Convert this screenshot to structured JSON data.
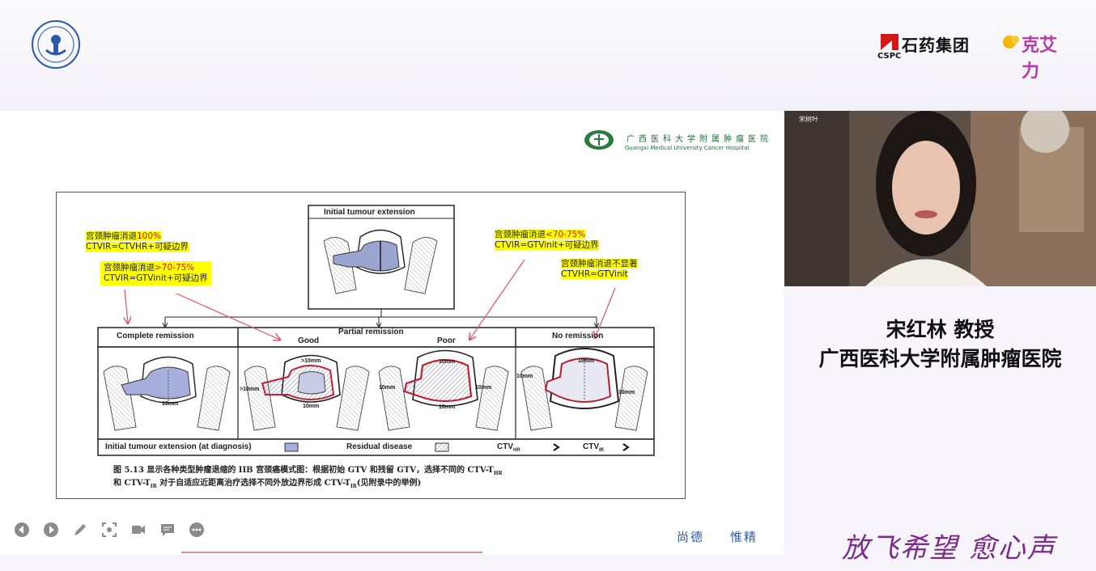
{
  "header": {
    "sponsor_cn": "石药集团",
    "sponsor_en": "CSPC",
    "brand": "克艾力"
  },
  "slide": {
    "hospital_cn": "广西医科大学附属肿瘤医院",
    "hospital_en": "Guangxi Medical University Cancer Hospital",
    "figure": {
      "top_box_label": "Initial tumour extension",
      "col_complete": "Complete remission",
      "col_partial": "Partial remission",
      "sub_good": "Good",
      "sub_poor": "Poor",
      "col_none": "No remission",
      "notes": {
        "n1_a": "宫颈肿瘤消退",
        "n1_b": "100%",
        "n1_c": "CTVIR=CTVHR+可疑边界",
        "n2_a": "宫颈肿瘤消退",
        "n2_b": ">70-75%",
        "n2_c": "CTVIR=GTVinit+可疑边界",
        "n3_a": "宫颈肿瘤消退",
        "n3_b": "<70-75%",
        "n3_c": "CTVIR=GTVinit+可疑边界",
        "n4_a": "宫颈肿瘤消退不显著",
        "n4_c": "CTVHR=GTVinit"
      },
      "mm": {
        "a": "10mm",
        "b": ">10mm",
        "c": ">10mm",
        "d": "10mm",
        "e": "10mm",
        "f": "10mm",
        "g": "10mm",
        "h": "10mm",
        "i": "10mm",
        "j": "10mm",
        "k": "10mm"
      },
      "legend": {
        "initial": "Initial tumour extension (at diagnosis)",
        "residual": "Residual disease",
        "ctv_hr": "CTV",
        "ctv_hr_sub": "HR",
        "ctv_ir": "CTV",
        "ctv_ir_sub": "IR"
      },
      "caption_line1": "图 5.13    显示各种类型肿瘤退缩的 IIB 宫颈癌模式图：根据初始 GTV 和残留 GTV，选择不同的 CTV-T",
      "caption_line1_sub": "HR",
      "caption_line2": "和 CTV-T",
      "caption_line2_sub": "IR",
      "caption_line2_rest": " 对于自适应近距离治疗选择不同外放边界形成 CTV-T",
      "caption_line2_sub2": "IR",
      "caption_line2_end": "(见附录中的举例)"
    },
    "motto_1": "尚德",
    "motto_2": "惟精"
  },
  "toolbar": {
    "icons": [
      "prev-icon",
      "next-icon",
      "pen-icon",
      "screenshot-icon",
      "camera-icon",
      "comment-icon",
      "more-icon"
    ]
  },
  "video": {
    "participant_label": "宋树叶"
  },
  "speaker": {
    "name": "宋红林 教授",
    "affiliation": "广西医科大学附属肿瘤医院"
  },
  "slogan": "放飞希望 愈心声",
  "colors": {
    "highlight": "#ffff00",
    "red_text": "#d31818",
    "arrow": "#e0506a",
    "motto": "#2b5ba8",
    "brand_purple": "#b53aa6"
  }
}
